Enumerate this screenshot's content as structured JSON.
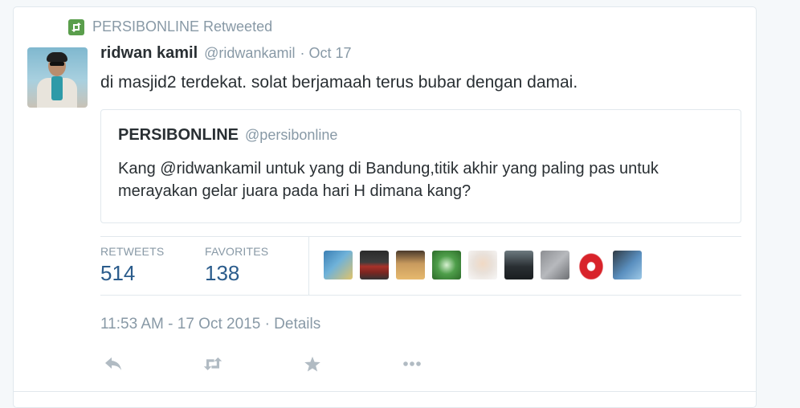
{
  "retweet_context": {
    "text": "PERSIBONLINE Retweeted",
    "icon": "retweet-icon",
    "badge_color": "#5a9e4c"
  },
  "tweet": {
    "author_name": "ridwan kamil",
    "author_handle": "@ridwankamil",
    "separator": "·",
    "date": "Oct 17",
    "text": "di masjid2 terdekat. solat berjamaah terus bubar dengan damai.",
    "avatar_icon": "user-avatar"
  },
  "quoted_tweet": {
    "author_name": "PERSIBONLINE",
    "author_handle": "@persibonline",
    "text": "Kang @ridwankamil untuk yang di Bandung,titik akhir yang paling pas untuk merayakan gelar juara pada hari H dimana kang?"
  },
  "stats": {
    "retweets_label": "RETWEETS",
    "retweets_value": "514",
    "favorites_label": "FAVORITES",
    "favorites_value": "138",
    "value_color": "#2b5c8c"
  },
  "favoriters": [
    {
      "icon": "favoriter-avatar-1"
    },
    {
      "icon": "favoriter-avatar-2"
    },
    {
      "icon": "favoriter-avatar-3"
    },
    {
      "icon": "favoriter-avatar-4"
    },
    {
      "icon": "favoriter-avatar-5"
    },
    {
      "icon": "favoriter-avatar-6"
    },
    {
      "icon": "favoriter-avatar-7"
    },
    {
      "icon": "favoriter-avatar-8"
    },
    {
      "icon": "favoriter-avatar-9"
    }
  ],
  "timestamp": {
    "text": "11:53 AM - 17 Oct 2015",
    "separator": "·",
    "details_label": "Details"
  },
  "actions": [
    {
      "icon": "reply-icon"
    },
    {
      "icon": "retweet-icon"
    },
    {
      "icon": "favorite-star-icon"
    },
    {
      "icon": "more-icon"
    }
  ],
  "colors": {
    "text": "#292f33",
    "muted": "#8899a6",
    "border": "#e1e8ed",
    "background": "#f5f8fa"
  }
}
